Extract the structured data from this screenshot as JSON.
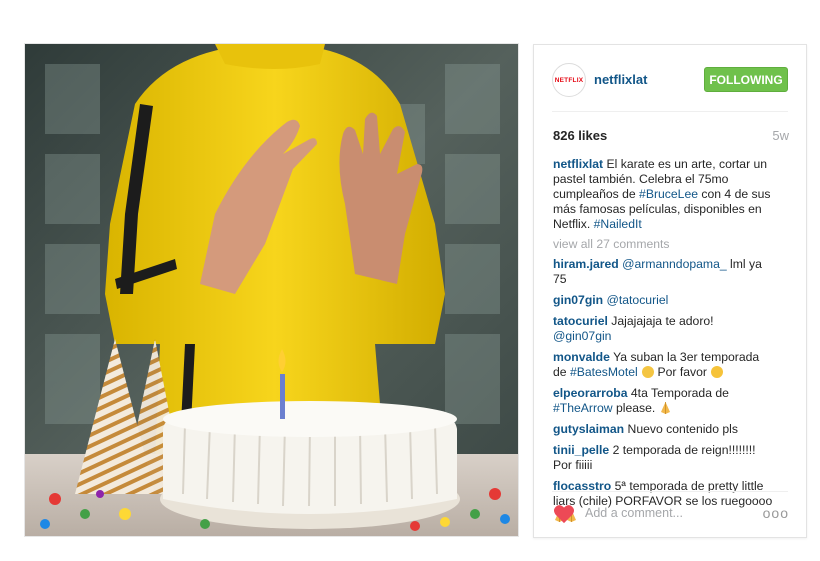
{
  "post": {
    "username": "netflixlat",
    "avatar_text": "NETFLIX",
    "follow_label": "FOLLOWING",
    "likes": "826 likes",
    "time": "5w",
    "caption_user": "netflixlat",
    "caption_parts": [
      "El karate es un arte, cortar un pastel también. Celebra el 75mo cumpleaños de ",
      "#BruceLee",
      " con 4 de sus más famosas películas, disponibles en Netflix. ",
      "#NailedIt"
    ],
    "view_all": "view all 27 comments",
    "comments": [
      {
        "user": "hiram.jared",
        "link": "@armanndopama_",
        "text": " lml ya 75"
      },
      {
        "user": "gin07gin",
        "link": "@tatocuriel",
        "text": ""
      },
      {
        "user": "tatocuriel",
        "text": "Jajajajaja te adoro! ",
        "link": "@gin07gin"
      },
      {
        "user": "monvalde",
        "text": "Ya suban la 3er temporada de ",
        "link": "#BatesMotel",
        "after": " Por favor"
      },
      {
        "user": "elpeorarroba",
        "text": "4ta Temporada de ",
        "link": "#TheArrow",
        "after": " please."
      },
      {
        "user": "gutyslaiman",
        "text": "Nuevo contenido pls"
      },
      {
        "user": "tinii_pelle",
        "text": "2 temporada de reign!!!!!!!! Por fiiiii"
      },
      {
        "user": "flocasstro",
        "text": "5ª temporada de pretty little liars (chile) PORFAVOR se los ruegoooo"
      }
    ],
    "add_comment_placeholder": "Add a comment...",
    "more_label": "ooo"
  },
  "colors": {
    "link": "#125688",
    "follow_green": "#6fc14b",
    "heart": "#ed4956",
    "muted": "#a5a7aa"
  },
  "icons": [
    "netflix-logo",
    "heart-icon",
    "more-options-icon",
    "smiley-emoji",
    "praying-hands-emoji"
  ]
}
